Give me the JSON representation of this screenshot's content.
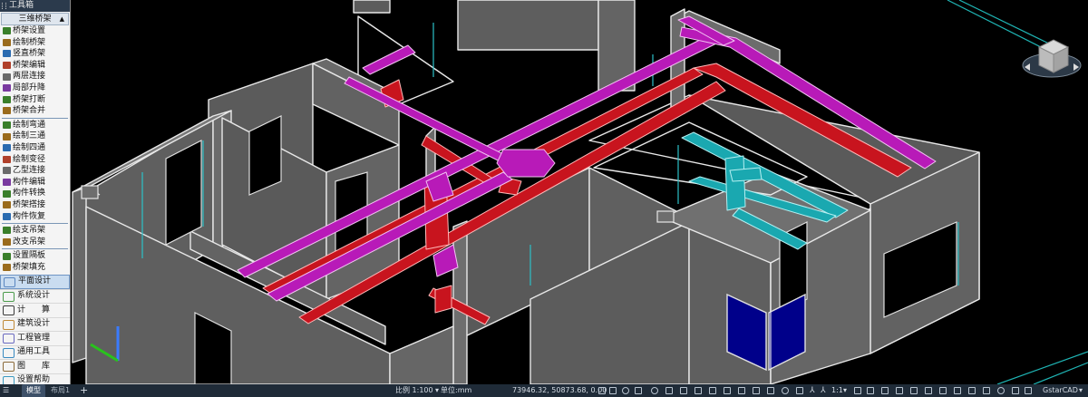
{
  "toolbox": {
    "title": "工具箱",
    "section_header": "三维桥架",
    "items_group1": [
      "桥架设置",
      "绘制桥架",
      "竖直桥架",
      "桥架编辑",
      "两层连接",
      "局部升降",
      "桥架打断",
      "桥架合并"
    ],
    "items_group2": [
      "绘制弯通",
      "绘制三通",
      "绘制四通",
      "绘制变径",
      "乙型连接",
      "构件编辑",
      "构件转换",
      "桥架搭接",
      "构件恢复"
    ],
    "items_group3": [
      "绘支吊架",
      "改支吊架"
    ],
    "items_group4": [
      "设置隔板",
      "桥架填充"
    ],
    "categories": [
      "平面设计",
      "系统设计",
      "计　　算",
      "建筑设计",
      "工程管理",
      "通用工具",
      "图　　库",
      "设置帮助"
    ],
    "active_category": "平面设计"
  },
  "statusbar": {
    "tab_model": "模型",
    "tab_layout": "布局1",
    "add_tab": "+",
    "scale": "比例 1:100",
    "unit": "单位:mm",
    "coordinates": "73946.32, 50873.68, 0.00",
    "annotation_scale": "1:1",
    "app_name": "GstarCAD"
  },
  "colors": {
    "cable_tray_magenta": "#b81ab8",
    "cable_tray_red": "#c8141e",
    "cable_tray_cyan": "#1aa8b0",
    "wall_gray": "#5f5f5f",
    "wall_edge": "#e6e6e6",
    "window_blue": "#00008a",
    "status_bg": "#1f2b38"
  }
}
